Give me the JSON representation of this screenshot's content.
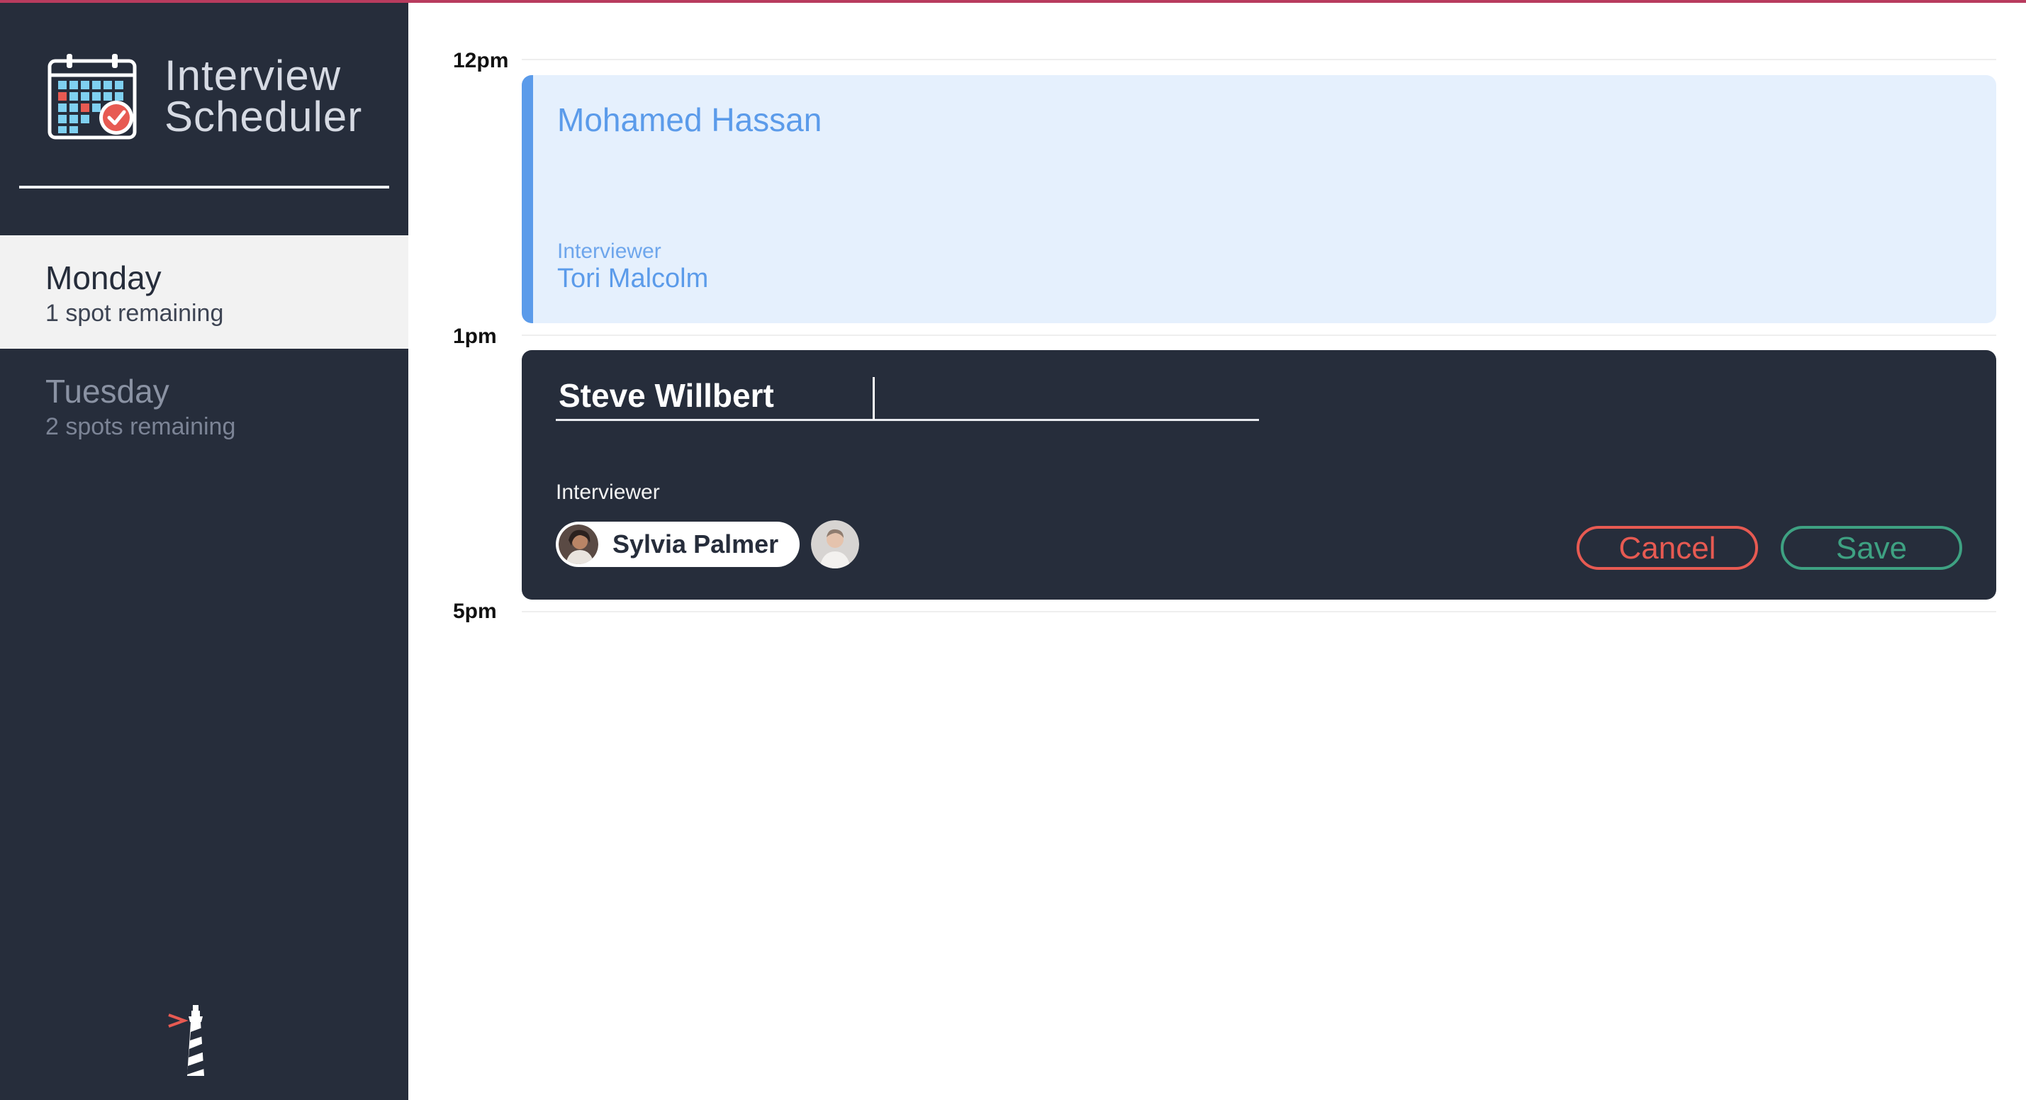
{
  "app": {
    "title_line1": "Interview",
    "title_line2": "Scheduler"
  },
  "days": [
    {
      "name": "Monday",
      "spots": "1 spot remaining",
      "selected": true
    },
    {
      "name": "Tuesday",
      "spots": "2 spots remaining",
      "selected": false
    }
  ],
  "schedule": {
    "time_slots": [
      "12pm",
      "1pm",
      "5pm"
    ],
    "appointment": {
      "student": "Mohamed Hassan",
      "interviewer_label": "Interviewer",
      "interviewer": "Tori Malcolm"
    },
    "form": {
      "student_name_value": "Steve Willbert",
      "interviewer_label": "Interviewer",
      "selected_interviewer": "Sylvia Palmer",
      "cancel_label": "Cancel",
      "save_label": "Save"
    }
  },
  "colors": {
    "sidebar_bg": "#262d3b",
    "accent_blue": "#5b9bea",
    "appointment_bg": "#e5f0fd",
    "cancel_red": "#e75a52",
    "save_green": "#3ea182",
    "top_strip": "#b83b5e"
  },
  "icons": {
    "logo": "calendar-check-icon",
    "footer": "lighthouse-icon"
  }
}
